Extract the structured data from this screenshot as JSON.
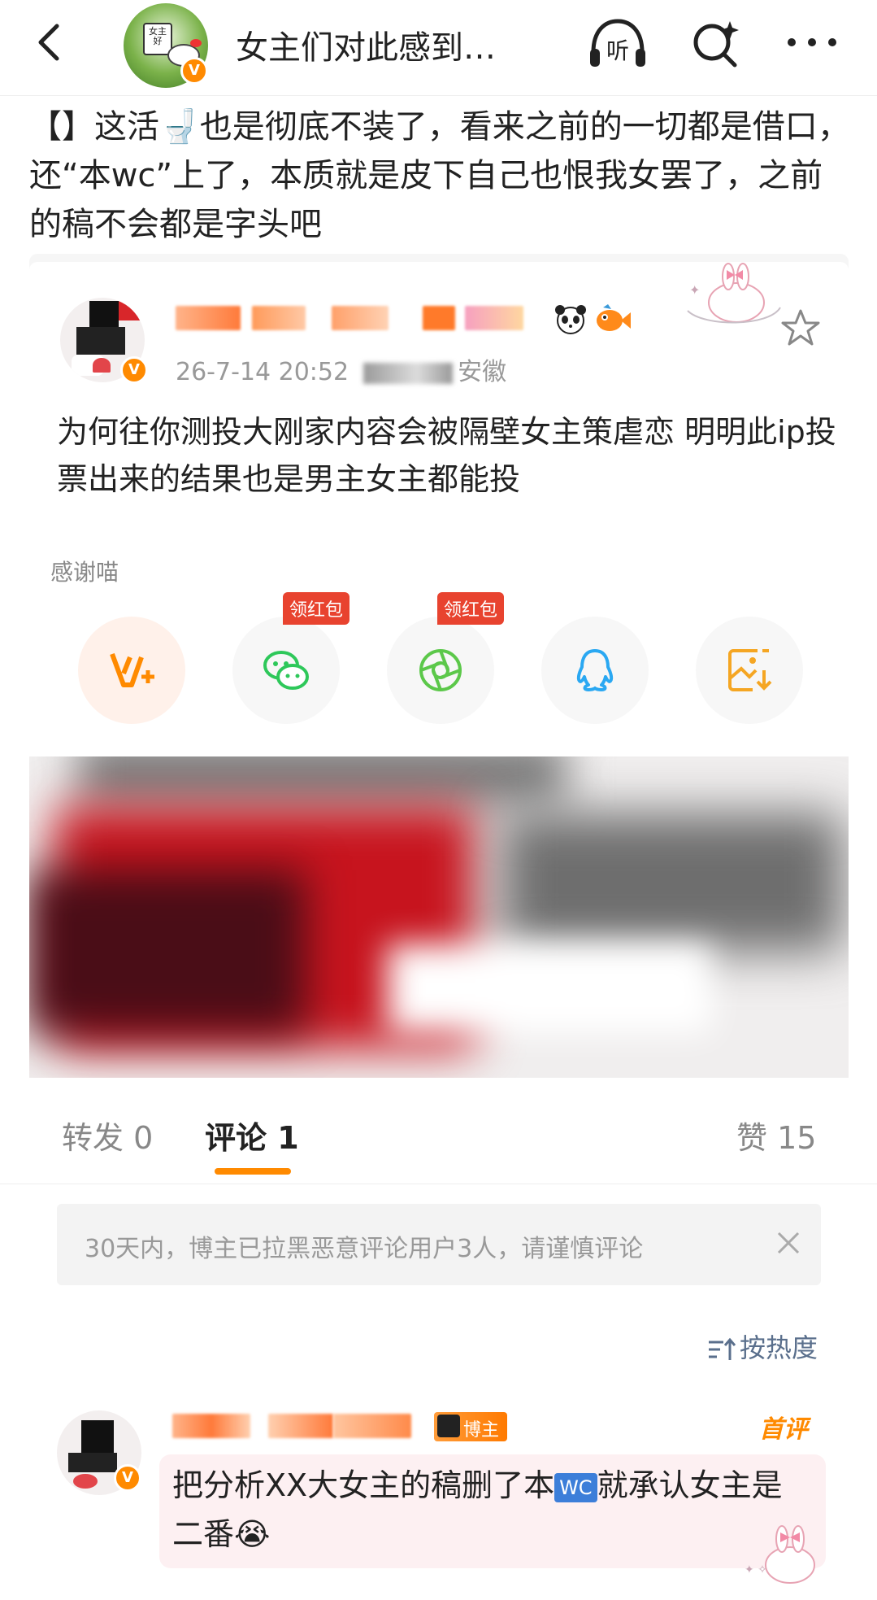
{
  "header": {
    "title": "女主们对此感到…",
    "avatar_sign": "女主好",
    "verified_badge": "V"
  },
  "post": {
    "text": "【】这活🚽也是彻底不装了，看来之前的一切都是借口，还“本wc”上了，本质就是皮下自己也恨我女罢了，之前的稿不会都是字头吧"
  },
  "repost": {
    "timestamp": "26-7-14 20:52",
    "location": "安徽",
    "text": "为何往你测投大刚家内容会被隔壁女主策虐恋 明明此ip投票出来的结果也是男主女主都能投",
    "thanks_label": "感谢喵",
    "share_buttons": [
      {
        "name": "vplus",
        "badge": ""
      },
      {
        "name": "wechat",
        "badge": "领红包"
      },
      {
        "name": "moments",
        "badge": "领红包"
      },
      {
        "name": "qq",
        "badge": ""
      },
      {
        "name": "save-image",
        "badge": ""
      }
    ]
  },
  "tabs": {
    "repost": "转发 0",
    "comment": "评论 1",
    "like": "赞 15"
  },
  "notice": {
    "text": "30天内，博主已拉黑恶意评论用户3人，请谨慎评论"
  },
  "sort": {
    "label": "按热度"
  },
  "comment": {
    "badge": "博主",
    "first_tag": "首评",
    "text_before": "把分析XX大女主的稿删了本",
    "wc": "WC",
    "text_after": "就承认女主是二番😭"
  },
  "colors": {
    "accent": "#ff8a00",
    "red_badge": "#e8432f",
    "link_blue": "#5a6f8c"
  }
}
